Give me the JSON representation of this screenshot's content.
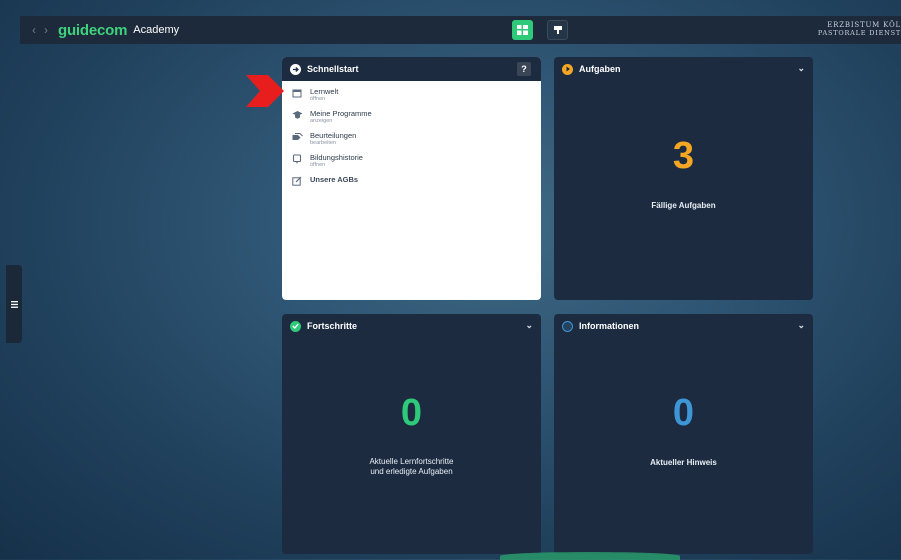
{
  "topbar": {
    "logo_main": "guidecom",
    "logo_sub": "Academy",
    "brand_line1": "ERZBISTUM KÖL",
    "brand_line2": "PASTORALE DIENST"
  },
  "cards": {
    "quickstart": {
      "title": "Schnellstart",
      "help": "?",
      "items": [
        {
          "label": "Lernwelt",
          "sub": "öffnen",
          "icon": "calendar-icon"
        },
        {
          "label": "Meine Programme",
          "sub": "anzeigen",
          "icon": "graduation-cap-icon"
        },
        {
          "label": "Beurteilungen",
          "sub": "bearbeiten",
          "icon": "tags-icon"
        },
        {
          "label": "Bildungshistorie",
          "sub": "öffnen",
          "icon": "history-icon"
        },
        {
          "label": "Unsere AGBs",
          "sub": "",
          "icon": "edit-icon"
        }
      ]
    },
    "tasks": {
      "title": "Aufgaben",
      "count": "3",
      "label": "Fällige Aufgaben",
      "color": "#f5a623"
    },
    "progress": {
      "title": "Fortschritte",
      "count": "0",
      "label_line1": "Aktuelle Lernfortschritte",
      "label_line2": "und erledigte Aufgaben",
      "color": "#2fc97a"
    },
    "info": {
      "title": "Informationen",
      "count": "0",
      "label": "Aktueller Hinweis",
      "color": "#3d96d6"
    }
  }
}
